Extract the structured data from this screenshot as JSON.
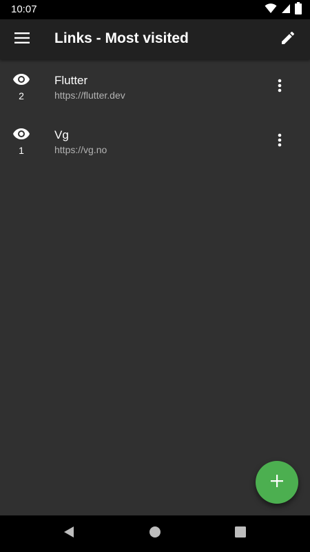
{
  "status_bar": {
    "time": "10:07",
    "icons": [
      "wifi-icon",
      "cell-signal-icon",
      "battery-icon"
    ]
  },
  "app_bar": {
    "title": "Links - Most visited",
    "menu_icon": "hamburger-menu-icon",
    "edit_icon": "pencil-icon"
  },
  "links": [
    {
      "title": "Flutter",
      "url": "https://flutter.dev",
      "visits": "2"
    },
    {
      "title": "Vg",
      "url": "https://vg.no",
      "visits": "1"
    }
  ],
  "fab": {
    "icon": "plus-icon",
    "color": "#4caf50"
  },
  "nav_bar": {
    "icons": [
      "back-icon",
      "home-icon",
      "recents-icon"
    ]
  },
  "colors": {
    "background": "#303030",
    "app_bar": "#212121",
    "secondary_text": "#b3b3b3"
  }
}
